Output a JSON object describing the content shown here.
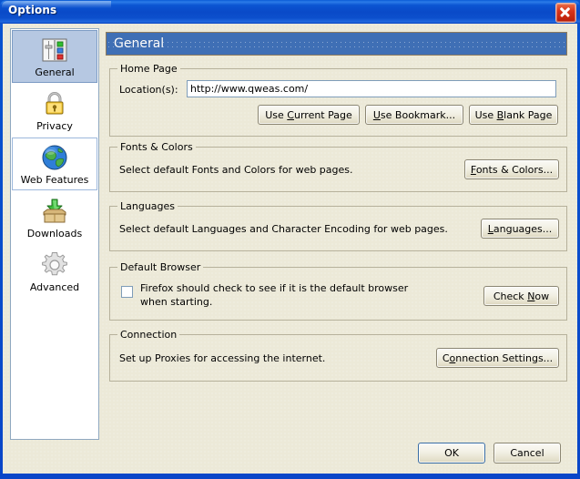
{
  "window": {
    "title": "Options",
    "close_icon": "close-icon"
  },
  "sidebar": {
    "items": [
      {
        "label": "General",
        "icon": "sliders-icon",
        "state": "selected"
      },
      {
        "label": "Privacy",
        "icon": "padlock-icon",
        "state": "normal"
      },
      {
        "label": "Web Features",
        "icon": "globe-icon",
        "state": "hover"
      },
      {
        "label": "Downloads",
        "icon": "download-box-icon",
        "state": "normal"
      },
      {
        "label": "Advanced",
        "icon": "gear-icon",
        "state": "normal"
      }
    ]
  },
  "pane": {
    "header_title": "General",
    "groups": {
      "home_page": {
        "title": "Home Page",
        "location_label": "Location(s):",
        "location_value": "http://www.qweas.com/",
        "buttons": [
          {
            "label": "Use Current Page",
            "accel": "C"
          },
          {
            "label": "Use Bookmark...",
            "accel": "U"
          },
          {
            "label": "Use Blank Page",
            "accel": "B"
          }
        ]
      },
      "fonts_colors": {
        "title": "Fonts & Colors",
        "description": "Select default Fonts and Colors for web pages.",
        "button_label": "Fonts & Colors...",
        "button_accel": "F"
      },
      "languages": {
        "title": "Languages",
        "description": "Select default Languages and Character Encoding for web pages.",
        "button_label": "Languages...",
        "button_accel": "L"
      },
      "default_browser": {
        "title": "Default Browser",
        "checkbox_label": "Firefox should check to see if it is the default browser when starting.",
        "checkbox_checked": false,
        "button_label": "Check Now",
        "button_accel": "N"
      },
      "connection": {
        "title": "Connection",
        "description": "Set up Proxies for accessing the internet.",
        "button_label": "Connection Settings...",
        "button_accel": "o"
      }
    }
  },
  "footer": {
    "ok_label": "OK",
    "cancel_label": "Cancel"
  },
  "colors": {
    "titlebar_blue": "#0A46C8",
    "header_banner": "#3F6FB5",
    "dialog_bg": "#ECE9D8",
    "selection_bg": "#B6C8E2",
    "close_red": "#D8341A"
  }
}
